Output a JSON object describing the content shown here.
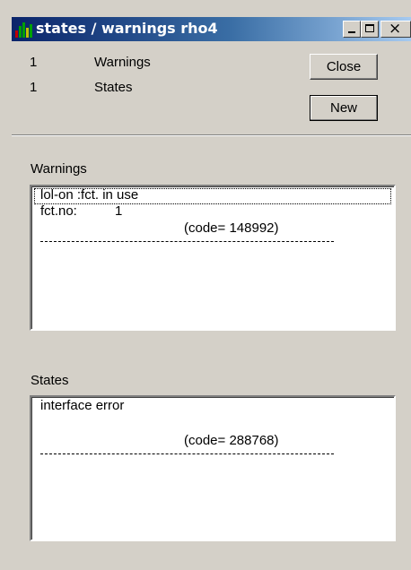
{
  "window": {
    "title": "states / warnings rho4",
    "minimize_glyph": "",
    "maximize_glyph": "",
    "close_glyph": "×"
  },
  "counts": {
    "warnings": {
      "number": "1",
      "label": "Warnings"
    },
    "states": {
      "number": "1",
      "label": "States"
    }
  },
  "buttons": {
    "close_label": "Close",
    "new_label": "New"
  },
  "warnings_section": {
    "label": "Warnings",
    "entry": {
      "title": "lol-on :fct. in use",
      "detail_label": "fct.no:",
      "detail_value": "1",
      "code": "(code= 148992)"
    }
  },
  "states_section": {
    "label": "States",
    "entry": {
      "title": "interface error",
      "code": "(code= 288768)"
    }
  },
  "colors": {
    "titlebar_start": "#0a246a",
    "titlebar_end": "#a6caf0",
    "face": "#d4d0c8"
  }
}
